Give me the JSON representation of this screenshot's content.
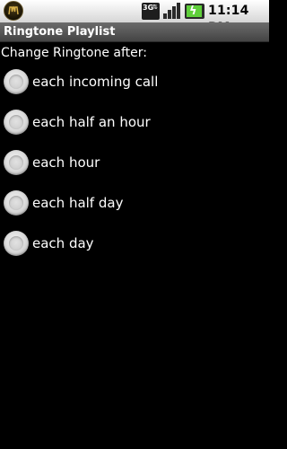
{
  "status_bar": {
    "network_label": "3G",
    "time": "11:14 PM",
    "icons": [
      "app-notification-icon",
      "network-3g-icon",
      "signal-icon",
      "battery-charging-icon"
    ]
  },
  "title_bar": {
    "title": "Ringtone Playlist"
  },
  "prompt": "Change Ringtone after:",
  "options": [
    {
      "label": "each incoming call",
      "selected": false
    },
    {
      "label": "each half an hour",
      "selected": false
    },
    {
      "label": "each hour",
      "selected": false
    },
    {
      "label": "each half day",
      "selected": false
    },
    {
      "label": "each day",
      "selected": false
    }
  ],
  "colors": {
    "background": "#000000",
    "text": "#ffffff",
    "status_bar": "#ffffff",
    "title_bar": "#555555",
    "battery_fill": "#5fcf3a"
  }
}
